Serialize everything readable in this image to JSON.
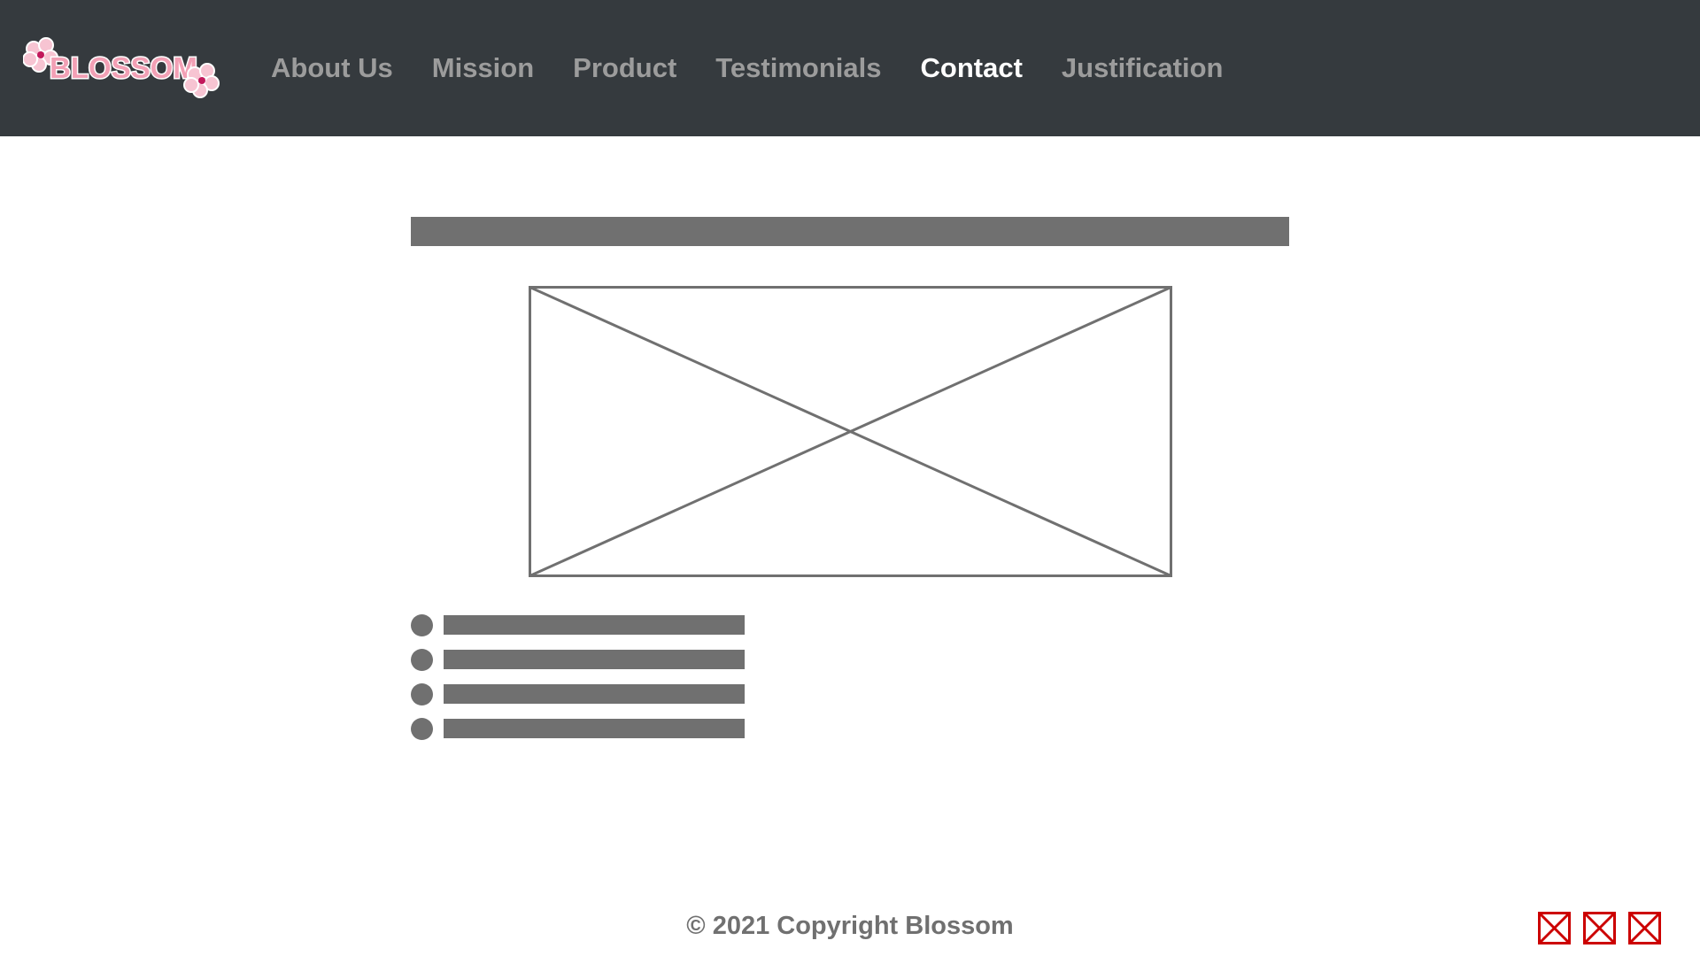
{
  "header": {
    "logo_text": "BLOSSOM",
    "logo_icon": "cherry-blossom-icon",
    "nav": [
      {
        "label": "About Us",
        "active": false
      },
      {
        "label": "Mission",
        "active": false
      },
      {
        "label": "Product",
        "active": false
      },
      {
        "label": "Testimonials",
        "active": false
      },
      {
        "label": "Contact",
        "active": true
      },
      {
        "label": "Justification",
        "active": false
      }
    ]
  },
  "main": {
    "image_icon": "image-placeholder-icon",
    "list_item_count": 4
  },
  "footer": {
    "copyright": "© 2021 Copyright Blossom",
    "social_icons": [
      "social-link-icon",
      "social-link-icon",
      "social-link-icon"
    ]
  },
  "colors": {
    "nav_background": "#353a3e",
    "nav_text": "#9c9c9c",
    "nav_active_text": "#ffffff",
    "placeholder_gray": "#707070",
    "logo_pink": "#f2a0b5",
    "social_icon_red": "#cc0000"
  }
}
